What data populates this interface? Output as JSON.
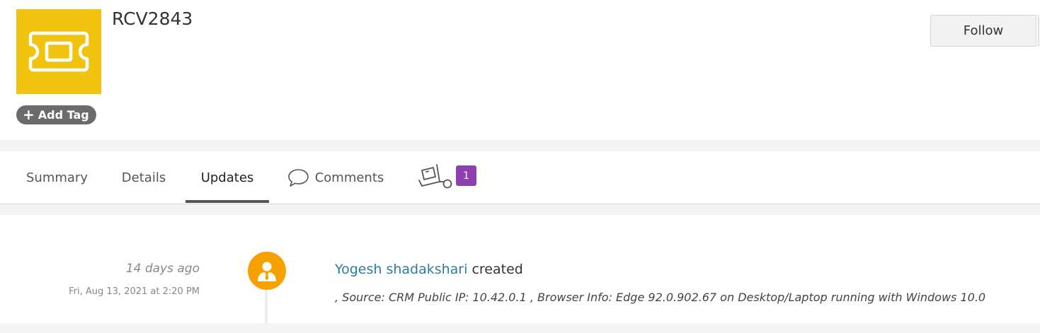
{
  "record": {
    "title": "RCV2843",
    "icon": "ticket-icon",
    "icon_color": "#f0c30f",
    "add_tag_label": "Add Tag"
  },
  "actions": {
    "follow_label": "Follow"
  },
  "tabs": [
    {
      "label": "Summary",
      "active": false
    },
    {
      "label": "Details",
      "active": false
    },
    {
      "label": "Updates",
      "active": true
    },
    {
      "label": "Comments",
      "icon": "comment-icon",
      "active": false
    },
    {
      "label": "",
      "icon": "delivery-truck-icon",
      "badge": "1",
      "badge_color": "#8e3fb0",
      "active": false
    }
  ],
  "feed": {
    "items": [
      {
        "time_ago": "14 days ago",
        "timestamp": "Fri, Aug 13, 2021 at 2:20 PM",
        "avatar_color": "#f6a100",
        "user": "Yogesh shadakshari",
        "action": "created",
        "detail": ", Source: CRM Public IP: 10.42.0.1 , Browser Info: Edge 92.0.902.67 on Desktop/Laptop running with Windows 10.0"
      }
    ]
  },
  "colors": {
    "link": "#2b7da0",
    "accent_underline": "#555555"
  }
}
